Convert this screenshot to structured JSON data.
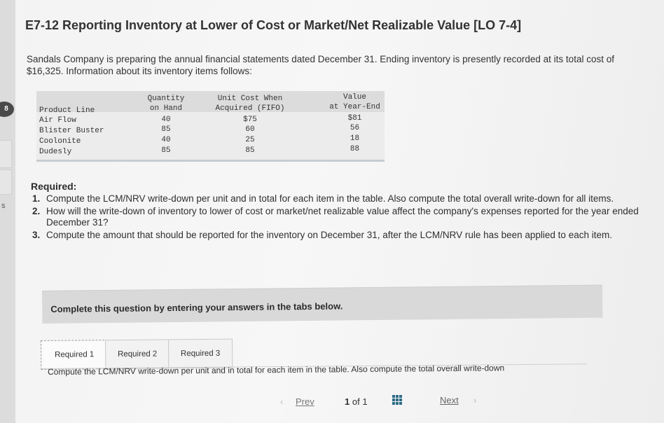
{
  "sidebar": {
    "badge": "8",
    "mark": "s"
  },
  "header": {
    "title": "E7-12 Reporting Inventory at Lower of Cost or Market/Net Realizable Value [LO 7-4]"
  },
  "intro": "Sandals Company is preparing the annual financial statements dated December 31. Ending inventory is presently recorded at its total cost of $16,325. Information about its inventory items follows:",
  "table": {
    "headers": {
      "product": "Product Line",
      "qty_1": "Quantity",
      "qty_2": "on Hand",
      "cost_1": "Unit Cost When",
      "cost_2": "Acquired (FIFO)",
      "value_1": "Value",
      "value_2": "at Year-End"
    },
    "rows": [
      {
        "product": "Air Flow",
        "qty": "40",
        "cost": "$75",
        "value": "$81"
      },
      {
        "product": "Blister Buster",
        "qty": "85",
        "cost": "60",
        "value": "56"
      },
      {
        "product": "Coolonite",
        "qty": "40",
        "cost": "25",
        "value": "18"
      },
      {
        "product": "Dudesly",
        "qty": "85",
        "cost": "85",
        "value": "88"
      }
    ]
  },
  "required": {
    "heading": "Required:",
    "items": [
      {
        "num": "1.",
        "text": "Compute the LCM/NRV write-down per unit and in total for each item in the table. Also compute the total overall write-down for all items."
      },
      {
        "num": "2.",
        "text": "How will the write-down of inventory to lower of cost or market/net realizable value affect the company's expenses reported for the year ended December 31?"
      },
      {
        "num": "3.",
        "text": "Compute the amount that should be reported for the inventory on December 31, after the LCM/NRV rule has been applied to each item."
      }
    ]
  },
  "banner": "Complete this question by entering your answers in the tabs below.",
  "tabs": [
    {
      "label": "Required 1"
    },
    {
      "label": "Required 2"
    },
    {
      "label": "Required 3"
    }
  ],
  "tab_content_preview": "Compute the LCM/NRV write-down per unit and in total for each item in the table. Also compute the total overall write-down",
  "pager": {
    "prev": "Prev",
    "current": "1",
    "of_label": "of",
    "total": "1",
    "next": "Next"
  }
}
